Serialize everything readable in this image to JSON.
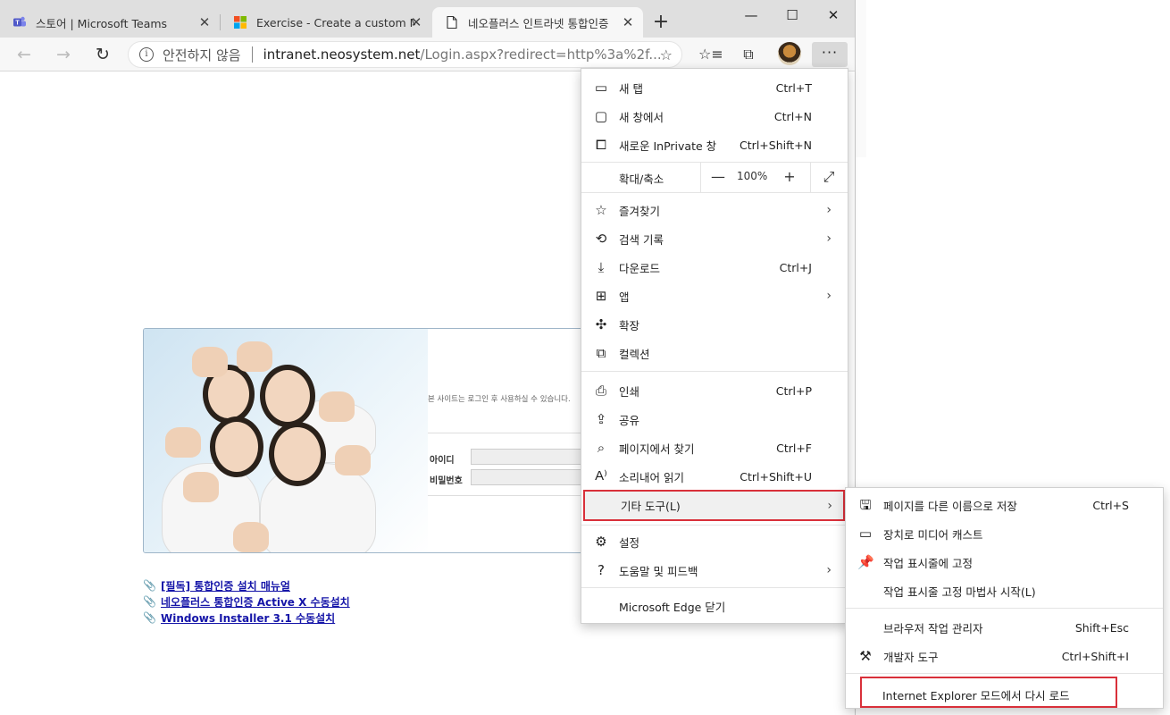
{
  "tabs": [
    {
      "title": "스토어 | Microsoft Teams",
      "icon": "teams-icon"
    },
    {
      "title": "Exercise - Create a custom Micro",
      "icon": "microsoft-logo-icon"
    },
    {
      "title": "네오플러스 인트라넷 통합인증",
      "icon": "page-icon"
    }
  ],
  "window": {
    "minimize": "—",
    "maximize": "☐",
    "close": "✕",
    "new_tab": "+"
  },
  "address": {
    "security": "안전하지 않음",
    "url_host": "intranet.neosystem.net",
    "url_path": "/Login.aspx?redirect=http%3a%2f..."
  },
  "page": {
    "notice": "본 사이트는 로그인 후 사용하실 수 있습니다.",
    "id_label": "아이디",
    "pw_label": "비밀번호",
    "links": [
      "[필독] 통합인증 설치 매뉴얼",
      "네오플러스 통합인증 Active X 수동설치",
      "Windows Installer 3.1 수동설치"
    ]
  },
  "menu": {
    "items": [
      {
        "label": "새 탭",
        "shortcut": "Ctrl+T",
        "icon": "new-tab-icon"
      },
      {
        "label": "새 창에서",
        "shortcut": "Ctrl+N",
        "icon": "new-window-icon"
      },
      {
        "label": "새로운 InPrivate 창",
        "shortcut": "Ctrl+Shift+N",
        "icon": "inprivate-icon"
      },
      {
        "label": "즐겨찾기",
        "shortcut": "",
        "icon": "favorites-icon"
      },
      {
        "label": "검색 기록",
        "shortcut": "",
        "icon": "history-icon"
      },
      {
        "label": "다운로드",
        "shortcut": "Ctrl+J",
        "icon": "download-icon"
      },
      {
        "label": "앱",
        "shortcut": "",
        "icon": "apps-icon"
      },
      {
        "label": "확장",
        "shortcut": "",
        "icon": "extensions-icon"
      },
      {
        "label": "컬렉션",
        "shortcut": "",
        "icon": "collections-icon"
      },
      {
        "label": "인쇄",
        "shortcut": "Ctrl+P",
        "icon": "print-icon"
      },
      {
        "label": "공유",
        "shortcut": "",
        "icon": "share-icon"
      },
      {
        "label": "페이지에서 찾기",
        "shortcut": "Ctrl+F",
        "icon": "find-icon"
      },
      {
        "label": "소리내어 읽기",
        "shortcut": "Ctrl+Shift+U",
        "icon": "read-aloud-icon"
      },
      {
        "label": "기타 도구(L)",
        "shortcut": "",
        "icon": ""
      },
      {
        "label": "설정",
        "shortcut": "",
        "icon": "settings-icon"
      },
      {
        "label": "도움말 및 피드백",
        "shortcut": "",
        "icon": "help-icon"
      },
      {
        "label": "Microsoft Edge 닫기",
        "shortcut": "",
        "icon": ""
      }
    ],
    "zoom": {
      "label": "확대/축소",
      "value": "100%",
      "minus": "—",
      "plus": "+"
    }
  },
  "submenu": {
    "items": [
      {
        "label": "페이지를 다른 이름으로 저장",
        "shortcut": "Ctrl+S",
        "icon": "save-page-icon"
      },
      {
        "label": "장치로 미디어 캐스트",
        "shortcut": "",
        "icon": "cast-icon"
      },
      {
        "label": "작업 표시줄에 고정",
        "shortcut": "",
        "icon": "pin-icon"
      },
      {
        "label": "작업 표시줄 고정 마법사 시작(L)",
        "shortcut": "",
        "icon": ""
      },
      {
        "label": "브라우저 작업 관리자",
        "shortcut": "Shift+Esc",
        "icon": ""
      },
      {
        "label": "개발자 도구",
        "shortcut": "Ctrl+Shift+I",
        "icon": "devtools-icon"
      },
      {
        "label": "Internet Explorer 모드에서 다시 로드",
        "shortcut": "",
        "icon": ""
      }
    ]
  },
  "colors": {
    "highlight_border": "#d9303a",
    "link": "#1515a8"
  }
}
